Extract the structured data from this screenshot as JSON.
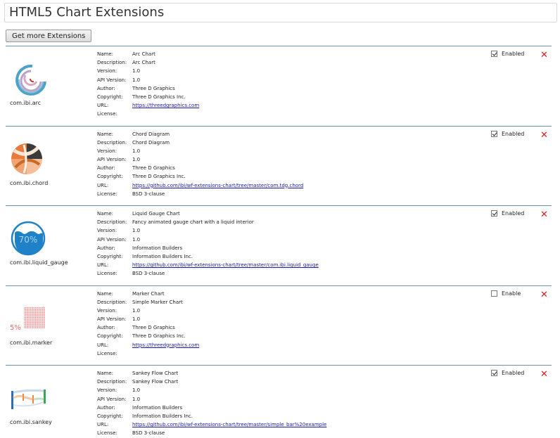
{
  "header": {
    "title": "HTML5 Chart Extensions"
  },
  "toolbar": {
    "get_more_label": "Get more Extensions"
  },
  "field_labels": {
    "name": "Name:",
    "description": "Description:",
    "version": "Version:",
    "api_version": "API Version:",
    "author": "Author:",
    "copyright": "Copyright:",
    "url": "URL:",
    "license": "License:"
  },
  "extensions": [
    {
      "id": "com.ibi.arc",
      "icon": "arc-chart-icon",
      "name": "Arc Chart",
      "description": "Arc Chart",
      "version": "1.0",
      "api_version": "1.0",
      "author": "Three D Graphics",
      "copyright": "Three D Graphics Inc.",
      "url": "https://threedgraphics.com",
      "license": "",
      "enabled": true,
      "enable_label": "Enabled"
    },
    {
      "id": "com.ibi.chord",
      "icon": "chord-diagram-icon",
      "name": "Chord Diagram",
      "description": "Chord Diagram",
      "version": "1.0",
      "api_version": "1.0",
      "author": "Three D Graphics",
      "copyright": "Three D Graphics Inc.",
      "url": "https://github.com/ibi/wf-extensions-chart/tree/master/com.tdg.chord",
      "license": "BSD 3-clause",
      "enabled": true,
      "enable_label": "Enabled"
    },
    {
      "id": "com.ibi.liquid_gauge",
      "icon": "liquid-gauge-icon",
      "icon_text": "70%",
      "name": "Liquid Gauge Chart",
      "description": "Fancy animated gauge chart with a liquid interior",
      "version": "1.0",
      "api_version": "1.0",
      "author": "Information Builders",
      "copyright": "Information Builders Inc.",
      "url": "https://github.com/ibi/wf-extensions-chart/tree/master/com.ibi.liquid_gauge",
      "license": "BSD 3-clause",
      "enabled": true,
      "enable_label": "Enabled"
    },
    {
      "id": "com.ibi.marker",
      "icon": "marker-chart-icon",
      "icon_text": "5%",
      "name": "Marker Chart",
      "description": "Simple Marker Chart",
      "version": "1.0",
      "api_version": "1.0",
      "author": "Three D Graphics",
      "copyright": "Three D Graphics Inc.",
      "url": "https://threedgraphics.com",
      "license": "",
      "enabled": false,
      "enable_label": "Enable"
    },
    {
      "id": "com.ibi.sankey",
      "icon": "sankey-chart-icon",
      "name": "Sankey Flow Chart",
      "description": "Sankey Flow Chart",
      "version": "1.0",
      "api_version": "1.0",
      "author": "Information Builders",
      "copyright": "Information Builders Inc.",
      "url": "https://github.com/ibi/wf-extensions-chart/tree/master/simple_bar%20example",
      "license": "BSD 3-clause",
      "enabled": true,
      "enable_label": "Enabled"
    }
  ],
  "colors": {
    "delete": "#d62020",
    "link": "#1a1aa6",
    "divider": "#6d8fb0"
  }
}
